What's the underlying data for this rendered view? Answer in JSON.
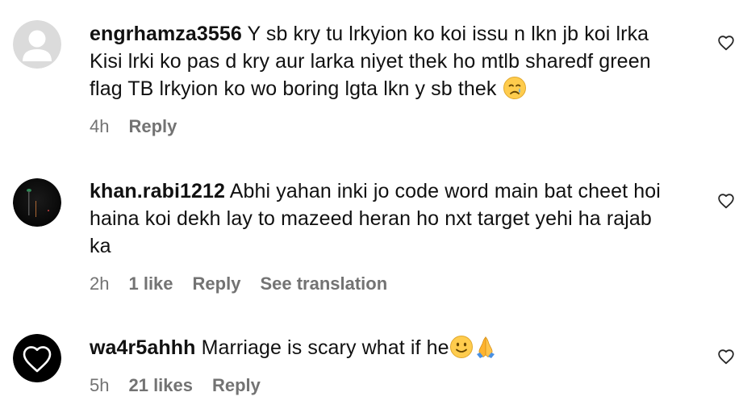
{
  "comments": [
    {
      "username": "engrhamza3556",
      "text_part1": "Y sb kry tu lrkyion ko koi issu n lkn jb koi lrka\nKisi lrki ko pas d kry aur larka niyet thek ho mtlb sharedf green\nflag TB lrkyion ko wo boring lgta lkn y sb thek ",
      "text_part2": "",
      "time": "4h",
      "likes": "",
      "reply_label": "Reply",
      "translate_label": "",
      "emoji_1": "crying-face",
      "avatar": "default-avatar"
    },
    {
      "username": "khan.rabi1212",
      "text_part1": "Abhi yahan inki jo code word main bat cheet hoi\nhaina koi dekh lay to mazeed heran ho nxt target yehi ha rajab\nka",
      "text_part2": "",
      "time": "2h",
      "likes": "1 like",
      "reply_label": "Reply",
      "translate_label": "See translation",
      "avatar": "dark-photo-avatar"
    },
    {
      "username": "wa4r5ahhh",
      "text_part1": "Marriage is scary what if he",
      "text_part2": "",
      "time": "5h",
      "likes": "21 likes",
      "reply_label": "Reply",
      "translate_label": "",
      "emoji_1": "slightly-smiling-face",
      "emoji_2": "folded-hands",
      "avatar": "heart-outline-avatar"
    }
  ],
  "colors": {
    "text": "#111111",
    "meta": "#737373",
    "avatar_default_bg": "#dbdbdb",
    "avatar_default_fg": "#ffffff"
  }
}
